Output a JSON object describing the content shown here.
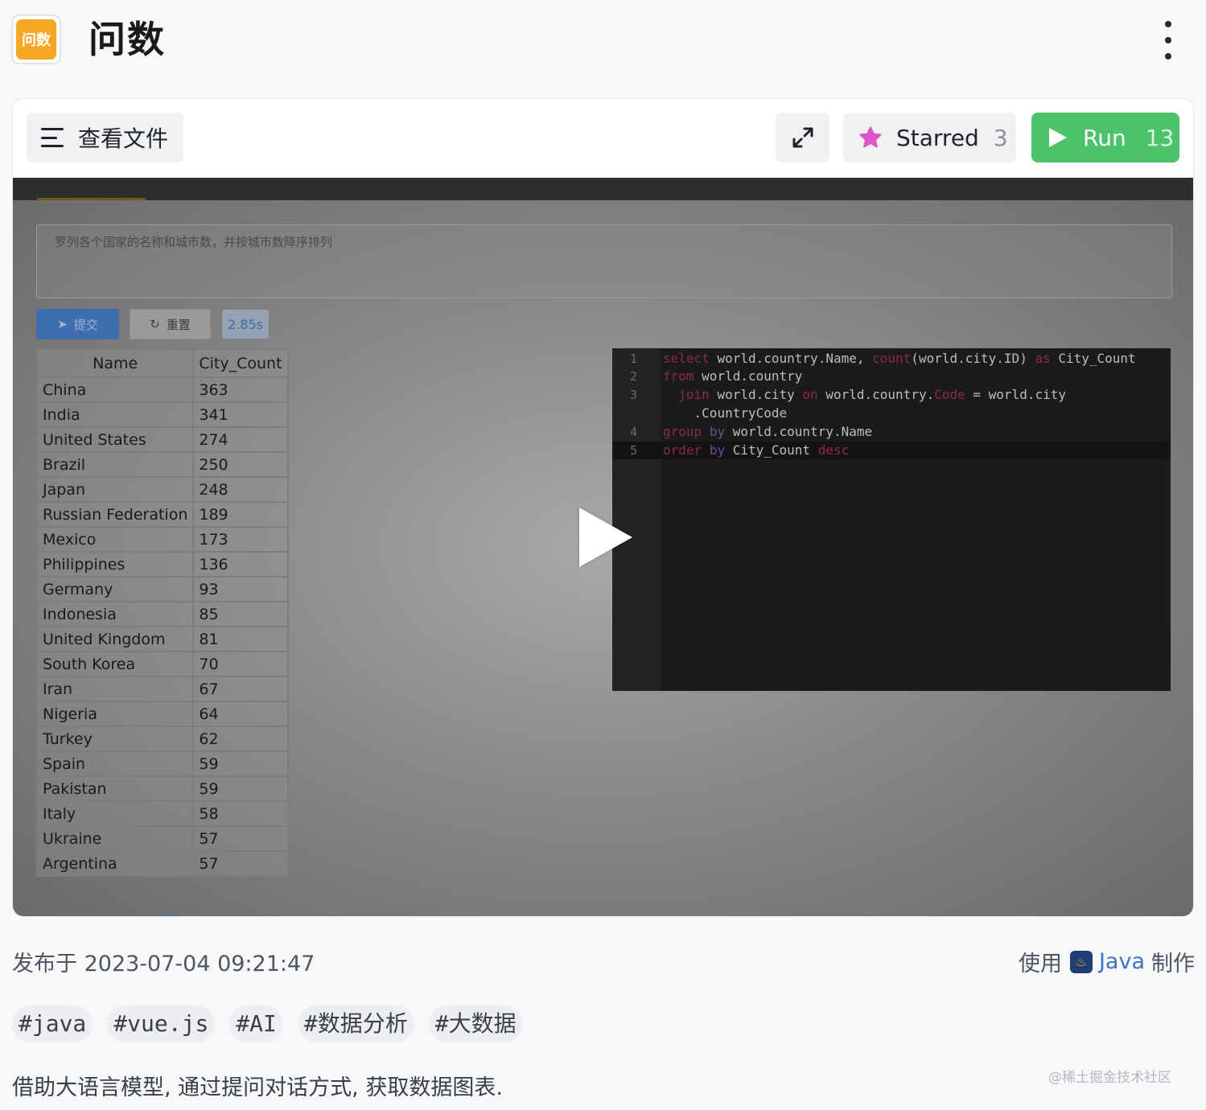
{
  "header": {
    "logo_text": "问数",
    "title": "问数"
  },
  "toolbar": {
    "files_label": "查看文件",
    "starred_label": "Starred",
    "starred_count": "3",
    "run_label": "Run",
    "run_count": "13"
  },
  "preview": {
    "question": "罗列各个国家的名称和城市数，并按城市数降序排列",
    "submit_label": "提交",
    "reset_label": "重置",
    "elapsed": "2.85s",
    "table": {
      "headers": [
        "Name",
        "City_Count"
      ],
      "rows": [
        [
          "China",
          "363"
        ],
        [
          "India",
          "341"
        ],
        [
          "United States",
          "274"
        ],
        [
          "Brazil",
          "250"
        ],
        [
          "Japan",
          "248"
        ],
        [
          "Russian Federation",
          "189"
        ],
        [
          "Mexico",
          "173"
        ],
        [
          "Philippines",
          "136"
        ],
        [
          "Germany",
          "93"
        ],
        [
          "Indonesia",
          "85"
        ],
        [
          "United Kingdom",
          "81"
        ],
        [
          "South Korea",
          "70"
        ],
        [
          "Iran",
          "67"
        ],
        [
          "Nigeria",
          "64"
        ],
        [
          "Turkey",
          "62"
        ],
        [
          "Spain",
          "59"
        ],
        [
          "Pakistan",
          "59"
        ],
        [
          "Italy",
          "58"
        ],
        [
          "Ukraine",
          "57"
        ],
        [
          "Argentina",
          "57"
        ]
      ]
    },
    "code_lines": [
      {
        "n": "1",
        "text": "select world.country.Name, count(world.city.ID) as City_Count"
      },
      {
        "n": "2",
        "text": "from world.country"
      },
      {
        "n": "3",
        "text": "  join world.city on world.country.Code = world.city"
      },
      {
        "n": "",
        "text": "    .CountryCode"
      },
      {
        "n": "4",
        "text": "group by world.country.Name"
      },
      {
        "n": "5",
        "text": "order by City_Count desc"
      }
    ]
  },
  "footer": {
    "published": "发布于 2023-07-04 09:21:47",
    "made_prefix": "使用",
    "language": "Java",
    "made_suffix": "制作",
    "tags": [
      "#java",
      "#vue.js",
      "#AI",
      "#数据分析",
      "#大数据"
    ],
    "description": "借助大语言模型, 通过提问对话方式, 获取数据图表.",
    "watermark": "@稀土掘金技术社区"
  },
  "colors": {
    "accent_run": "#4cc36a",
    "star": "#e056c8",
    "logo": "#f5a623",
    "link": "#3d73c9"
  },
  "icons": [
    "menu-icon",
    "expand-icon",
    "star-icon",
    "play-icon",
    "kebab-menu-icon",
    "java-icon"
  ]
}
